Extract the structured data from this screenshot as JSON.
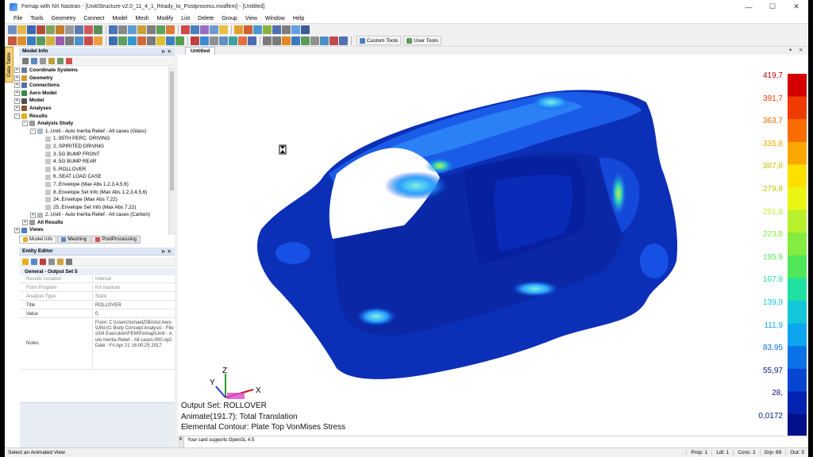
{
  "window": {
    "title": "Femap with NX Nastran - [UnitiStructure v2.0_11_4_1_Ready_to_Postprocess.modfem] - [Untitled]",
    "controls": [
      "—",
      "☐",
      "✕"
    ]
  },
  "menu": [
    "File",
    "Tools",
    "Geometry",
    "Connect",
    "Model",
    "Mesh",
    "Modify",
    "List",
    "Delete",
    "Group",
    "View",
    "Window",
    "Help"
  ],
  "toolbar": {
    "custom_tools_label": "Custom Tools",
    "user_tools_label": "User Tools"
  },
  "side_tab": {
    "label": "Data Table"
  },
  "model_info": {
    "title": "Model Info",
    "tree": [
      {
        "label": "Coordinate Systems",
        "level": 0,
        "bold": true,
        "exp": "+",
        "icon": "#6b7aa0"
      },
      {
        "label": "Geometry",
        "level": 0,
        "bold": true,
        "exp": "+",
        "icon": "#d29b2c"
      },
      {
        "label": "Connections",
        "level": 0,
        "bold": true,
        "exp": "+",
        "icon": "#5a6fb0"
      },
      {
        "label": "Aero Model",
        "level": 0,
        "bold": true,
        "exp": "+",
        "icon": "#3b8a4a"
      },
      {
        "label": "Model",
        "level": 0,
        "bold": true,
        "exp": "+",
        "icon": "#505050"
      },
      {
        "label": "Analyses",
        "level": 0,
        "bold": true,
        "exp": "+",
        "icon": "#8a5a2a"
      },
      {
        "label": "Results",
        "level": 0,
        "bold": true,
        "exp": "−",
        "icon": "#e0b020"
      },
      {
        "label": "Analysis Study",
        "level": 1,
        "bold": true,
        "exp": "−",
        "icon": "#9a9a9a"
      },
      {
        "label": "1..Uniti - Auto Inertia Relief - All cases (Glass)",
        "level": 2,
        "bold": false,
        "exp": "−",
        "icon": "#b0b8c8"
      },
      {
        "label": "1..95TH PERC. DRIVING",
        "level": 3,
        "bold": false,
        "exp": "",
        "icon": "#c8c8c8"
      },
      {
        "label": "2..SPIRITED DRIVING",
        "level": 3,
        "bold": false,
        "exp": "",
        "icon": "#c8c8c8"
      },
      {
        "label": "3..5G BUMP FRONT",
        "level": 3,
        "bold": false,
        "exp": "",
        "icon": "#c8c8c8"
      },
      {
        "label": "4..5G BUMP REAR",
        "level": 3,
        "bold": false,
        "exp": "",
        "icon": "#c8c8c8"
      },
      {
        "label": "5..ROLLOVER",
        "level": 3,
        "bold": false,
        "exp": "",
        "icon": "#c8c8c8"
      },
      {
        "label": "6..SEAT LOAD CASE",
        "level": 3,
        "bold": false,
        "exp": "",
        "icon": "#c8c8c8"
      },
      {
        "label": "7..Envelope (Max Abs 1,2,3,4,5,6)",
        "level": 3,
        "bold": false,
        "exp": "",
        "icon": "#c8c8c8"
      },
      {
        "label": "8..Envelope Set Info (Max Abs 1,2,3,4,5,6)",
        "level": 3,
        "bold": false,
        "exp": "",
        "icon": "#c8c8c8"
      },
      {
        "label": "24..Envelope (Max Abs 7,22)",
        "level": 3,
        "bold": false,
        "exp": "",
        "icon": "#c8c8c8"
      },
      {
        "label": "25..Envelope Set Info (Max Abs 7,22)",
        "level": 3,
        "bold": false,
        "exp": "",
        "icon": "#c8c8c8"
      },
      {
        "label": "2..Uniti - Auto Inertia Relief - All cases (Carbon)",
        "level": 2,
        "bold": false,
        "exp": "+",
        "icon": "#b0b8c8"
      },
      {
        "label": "All Results",
        "level": 1,
        "bold": true,
        "exp": "+",
        "icon": "#9a9a9a"
      },
      {
        "label": "Views",
        "level": 0,
        "bold": true,
        "exp": "+",
        "icon": "#4a7fc0"
      }
    ],
    "tabs": [
      "Model Info",
      "Meshing",
      "PostProcessing"
    ]
  },
  "entity_editor": {
    "title": "Entity Editor",
    "group_label": "General - Output Set 5",
    "props": [
      {
        "key": "Results Location",
        "value": "Internal",
        "dim": true
      },
      {
        "key": "From Program",
        "value": "NX Nastran",
        "dim": true
      },
      {
        "key": "Analysis Type",
        "value": "Static",
        "dim": true
      },
      {
        "key": "Title",
        "value": "ROLLOVER",
        "dim": false
      },
      {
        "key": "Value",
        "value": "0,",
        "dim": false
      },
      {
        "key": "Notes",
        "value": "From: C:\\Users\\IsmaelZ\\Bristol Aero\\UNI-01 Body Concept Analysis - Files\\04 Execution\\FEM\\Femap\\Uniti - Auto Inertia Relief - All cases-000.op2\nDate : Fri Apr 21 16:00:25 2017",
        "dim": false
      }
    ]
  },
  "view": {
    "tab_label": "Untitled",
    "overlay": {
      "output_set": "Output Set: ROLLOVER",
      "animate": "Animate(191.7): Total Translation",
      "contour": "Elemental Contour: Plate Top VonMises Stress"
    },
    "axes": {
      "x": "X",
      "y": "Y",
      "z": "Z"
    },
    "legend": {
      "labels": [
        "419,7",
        "391,7",
        "363,7",
        "335,8",
        "307,8",
        "279,8",
        "251,8",
        "223,8",
        "195,9",
        "167,9",
        "139,9",
        "111,9",
        "83,95",
        "55,97",
        "28,",
        "0,0172"
      ],
      "colors": [
        "#d40000",
        "#ef3a00",
        "#f86c00",
        "#fba700",
        "#fde000",
        "#eaf515",
        "#b8f02c",
        "#84eb40",
        "#4fe65a",
        "#1fe0a0",
        "#12c8d8",
        "#0da5ee",
        "#0a72e4",
        "#0646d2",
        "#0222b0",
        "#00108a"
      ]
    }
  },
  "messages": [
    "Your card supports OpenGL 4.5"
  ],
  "status": {
    "left": "Select an Animated View",
    "cells": [
      "Prop: 1",
      "Ldl: 1",
      "Cons: 2",
      "Grp: 69",
      "Out: 5"
    ]
  }
}
